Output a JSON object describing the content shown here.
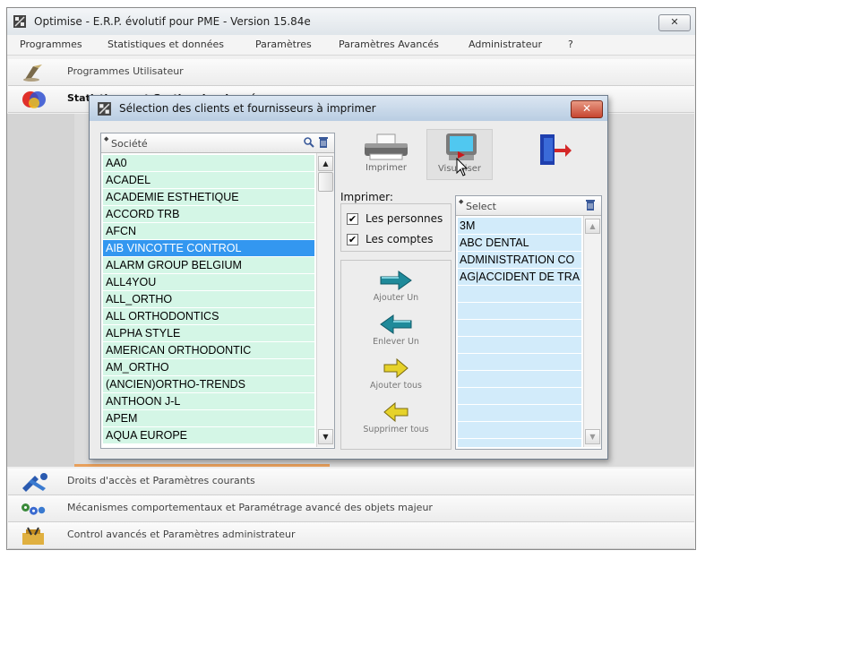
{
  "window": {
    "title": "Optimise  -  E.R.P. évolutif pour PME  -  Version 15.84e",
    "close_label": "✕"
  },
  "menu": [
    "Programmes",
    "Statistiques et données",
    "Paramètres",
    "Paramètres Avancés",
    "Administrateur",
    "?"
  ],
  "sections": {
    "programmes": "Programmes Utilisateur",
    "stats": "Statistiques et Gestion des données",
    "droits": "Droits d'accès et Paramètres courants",
    "mecanismes": "Mécanismes comportementaux et Paramétrage avancé des objets majeur",
    "control": "Control avancés et Paramètres administrateur"
  },
  "dialog": {
    "title": "Sélection des clients et fournisseurs à imprimer",
    "close_label": "✕",
    "company_list": {
      "header": "Société",
      "selected_index": 5,
      "items": [
        "AA0",
        "ACADEL",
        "ACADEMIE ESTHETIQUE",
        "ACCORD TRB",
        "AFCN",
        "AIB VINCOTTE CONTROL",
        "ALARM GROUP BELGIUM",
        "ALL4YOU",
        "ALL_ORTHO",
        "ALL ORTHODONTICS",
        "ALPHA STYLE",
        "AMERICAN ORTHODONTIC",
        "AM_ORTHO",
        "(ANCIEN)ORTHO-TRENDS",
        "ANTHOON J-L",
        "APEM",
        "AQUA EUROPE"
      ]
    },
    "toolbar": {
      "print_label": "Imprimer",
      "preview_label": "Visualiser"
    },
    "print_options": {
      "title": "Imprimer:",
      "persons_label": "Les personnes",
      "persons_checked": true,
      "accounts_label": "Les comptes",
      "accounts_checked": true
    },
    "transfer": {
      "add_one": "Ajouter Un",
      "remove_one": "Enlever Un",
      "add_all": "Ajouter tous",
      "remove_all": "Supprimer tous"
    },
    "selected_list": {
      "header": "Select",
      "items": [
        "3M",
        "ABC DENTAL",
        "ADMINISTRATION CO",
        "AG|ACCIDENT DE TRA"
      ]
    }
  },
  "colors": {
    "list_row": "#d4f6e6",
    "list_selected": "#3397f0",
    "selected_row": "#d2ebfa",
    "dialog_close": "#c64530",
    "arrow_teal": "#1f8a9a",
    "arrow_yellow": "#e6d22a"
  }
}
